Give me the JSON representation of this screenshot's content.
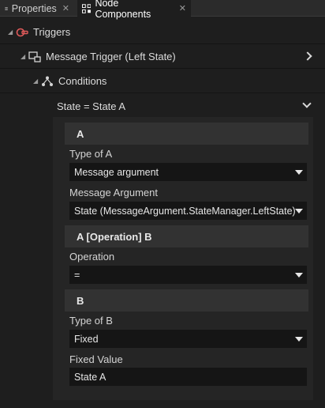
{
  "tabs": [
    {
      "label": "Properties",
      "icon": "list-icon",
      "active": false
    },
    {
      "label": "Node Components",
      "icon": "components-icon",
      "active": true
    }
  ],
  "tree": {
    "triggers_label": "Triggers",
    "message_trigger_label": "Message Trigger (Left State)",
    "conditions_label": "Conditions",
    "condition_item_label": "State = State A"
  },
  "condition": {
    "section_a": "A",
    "type_of_a_label": "Type of A",
    "type_of_a_value": "Message argument",
    "message_argument_label": "Message Argument",
    "message_argument_value": "State (MessageArgument.StateManager.LeftState)",
    "section_operation": "A [Operation] B",
    "operation_label": "Operation",
    "operation_value": "=",
    "section_b": "B",
    "type_of_b_label": "Type of B",
    "type_of_b_value": "Fixed",
    "fixed_value_label": "Fixed Value",
    "fixed_value_value": "State A"
  },
  "colors": {
    "background": "#1e1e1e",
    "panel": "#252525",
    "section_header": "#323232",
    "field": "#151515",
    "trigger_icon": "#e05a5a"
  }
}
